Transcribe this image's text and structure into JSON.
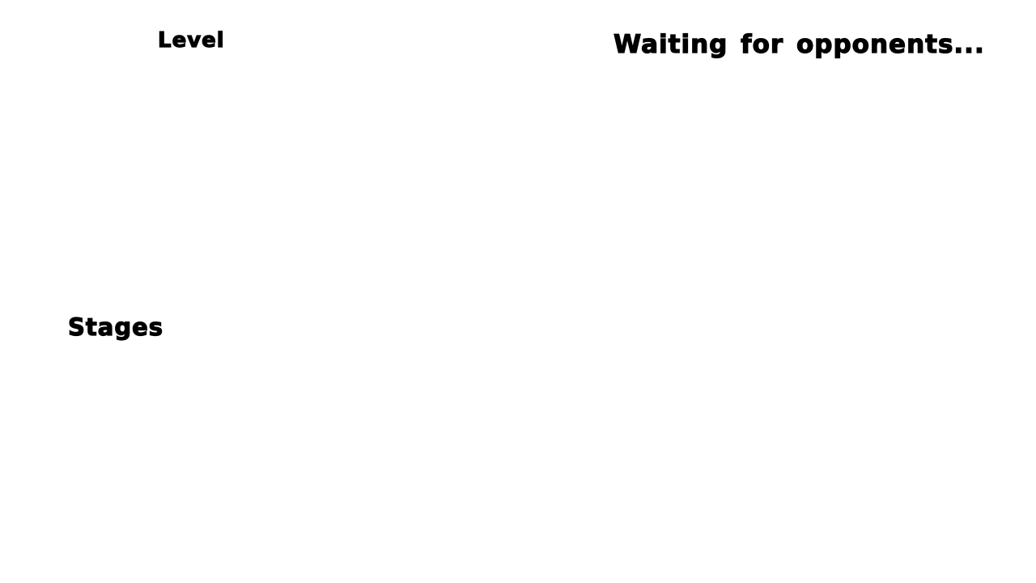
{
  "level": {
    "title": "Level"
  },
  "lobby": {
    "status_text": "Waiting for opponents..."
  },
  "stages": {
    "title": "Stages"
  },
  "colors": {
    "background": "#ffffff",
    "text": "#000000"
  }
}
